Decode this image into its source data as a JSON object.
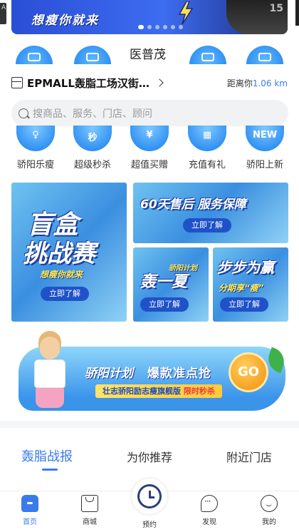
{
  "banner": {
    "slogan": "想瘦你就来",
    "status_number": "15",
    "slides": 6,
    "active_slide": 0
  },
  "doctor_name": "医普茂",
  "store": {
    "name": "EPMALL轰脂工场汉街…",
    "distance_prefix": "距离你",
    "distance_value": "1.06 km"
  },
  "search": {
    "placeholder": "搜商品、服务、门店、顾问"
  },
  "categories": [
    {
      "label": "骄阳乐瘦",
      "icon": "slim-icon"
    },
    {
      "label": "超级秒杀",
      "icon": "flash-sale-icon",
      "badge": "秒"
    },
    {
      "label": "超值买赠",
      "icon": "yuan-icon",
      "badge": "¥"
    },
    {
      "label": "充值有礼",
      "icon": "gift-icon"
    },
    {
      "label": "骄阳上新",
      "icon": "new-icon",
      "badge": "NEW"
    }
  ],
  "promos": {
    "blindbox": {
      "line1": "盲盒",
      "line2": "挑战赛",
      "sub": "想瘦你就来",
      "cta": "立即了解"
    },
    "aftersale": {
      "title": "60天售后 服务保障",
      "cta": "立即了解"
    },
    "plan": {
      "tag": "骄阳计划",
      "title": "轰一夏",
      "cta": "立即了解"
    },
    "step": {
      "title": "步步为赢",
      "sub": "分期享“瘦”",
      "cta": "立即了解"
    }
  },
  "wide_promo": {
    "brand": "骄阳计划",
    "headline": "爆款准点抢",
    "strip_text": "壮志骄阳励志瘦旗舰版 ",
    "strip_highlight": "限时秒杀",
    "go_label": "GO"
  },
  "tabs": [
    {
      "label": "轰脂战报",
      "active": true
    },
    {
      "label": "为你推荐",
      "active": false
    },
    {
      "label": "附近门店",
      "active": false
    }
  ],
  "bottom_nav": [
    {
      "label": "首页",
      "icon": "home-icon",
      "active": true
    },
    {
      "label": "商城",
      "icon": "shop-bag-icon",
      "active": false
    },
    {
      "label": "预约",
      "icon": "clock-icon",
      "active": false
    },
    {
      "label": "发现",
      "icon": "chat-bubble-icon",
      "active": false
    },
    {
      "label": "我的",
      "icon": "profile-face-icon",
      "active": false
    }
  ],
  "colors": {
    "accent": "#3a7bea",
    "promo_blue": "#1f52c8",
    "highlight_yellow": "#ffe94a"
  }
}
